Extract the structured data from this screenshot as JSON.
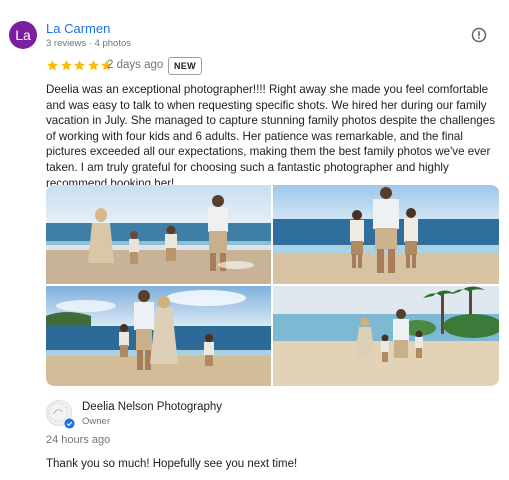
{
  "review": {
    "avatar_initials": "La",
    "reviewer_name": "La Carmen",
    "reviewer_meta": "3 reviews · 4 photos",
    "rating": 5,
    "date": "2 days ago",
    "badge": "NEW",
    "text": "Deelia was an exceptional photographer!!!! Right away she made you feel comfortable and was easy to talk to when requesting specific shots. We hired her during our family vacation in July. She managed to capture stunning family photos despite the challenges of working with four kids and 6 adults. Her patience was remarkable, and the final pictures exceeded all our expectations, making them the best family photos we've ever taken. I am truly grateful for choosing such a fantastic photographer and highly recommend booking her!",
    "photos": [
      "family-beach-walk",
      "family-standing-shore",
      "couple-with-kids-beach",
      "family-walking-palms"
    ],
    "icons": {
      "report": "report-flag-icon",
      "star": "star-icon"
    },
    "colors": {
      "avatar_bg": "#7b1fa2",
      "name_link": "#1a73e8",
      "star": "#fbbc04"
    }
  },
  "owner_response": {
    "name": "Deelia Nelson Photography",
    "role": "Owner",
    "time": "24 hours ago",
    "text": "Thank you so much! Hopefully see you next time!",
    "icons": {
      "verified": "verified-badge-icon",
      "logo": "business-logo"
    }
  }
}
